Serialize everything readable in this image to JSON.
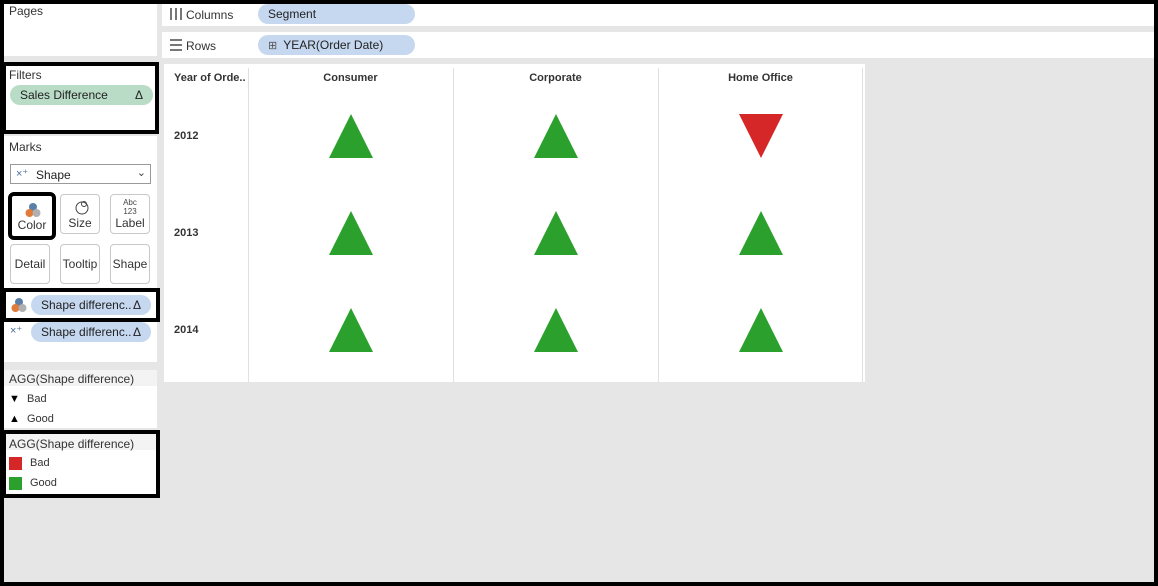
{
  "pages": {
    "title": "Pages"
  },
  "filters": {
    "title": "Filters",
    "pill": "Sales Difference",
    "delta": "Δ"
  },
  "marks": {
    "title": "Marks",
    "type_select": "Shape",
    "buttons": {
      "color": "Color",
      "size": "Size",
      "label": "Label",
      "label_glyph": "Abc\n123",
      "detail": "Detail",
      "tooltip": "Tooltip",
      "shape": "Shape"
    },
    "pills": [
      {
        "label": "Shape differenc..",
        "delta": "Δ"
      },
      {
        "label": "Shape differenc..",
        "delta": "Δ"
      }
    ]
  },
  "shape_legend": {
    "title": "AGG(Shape difference)",
    "items": [
      {
        "glyph": "▼",
        "label": "Bad"
      },
      {
        "glyph": "▲",
        "label": "Good"
      }
    ]
  },
  "color_legend": {
    "title": "AGG(Shape difference)",
    "items": [
      {
        "color": "#d62728",
        "label": "Bad"
      },
      {
        "color": "#2ca02c",
        "label": "Good"
      }
    ]
  },
  "shelves": {
    "columns": {
      "label": "Columns",
      "pill": "Segment"
    },
    "rows": {
      "label": "Rows",
      "pill": "YEAR(Order Date)",
      "expand": "⊞"
    }
  },
  "colors": {
    "good": "#2ca02c",
    "bad": "#d62728"
  },
  "chart_data": {
    "type": "table",
    "row_header": "Year of Orde..",
    "columns": [
      "Consumer",
      "Corporate",
      "Home Office"
    ],
    "rows": [
      "2012",
      "2013",
      "2014"
    ],
    "values": [
      [
        "Good",
        "Good",
        "Bad"
      ],
      [
        "Good",
        "Good",
        "Good"
      ],
      [
        "Good",
        "Good",
        "Good"
      ]
    ]
  }
}
